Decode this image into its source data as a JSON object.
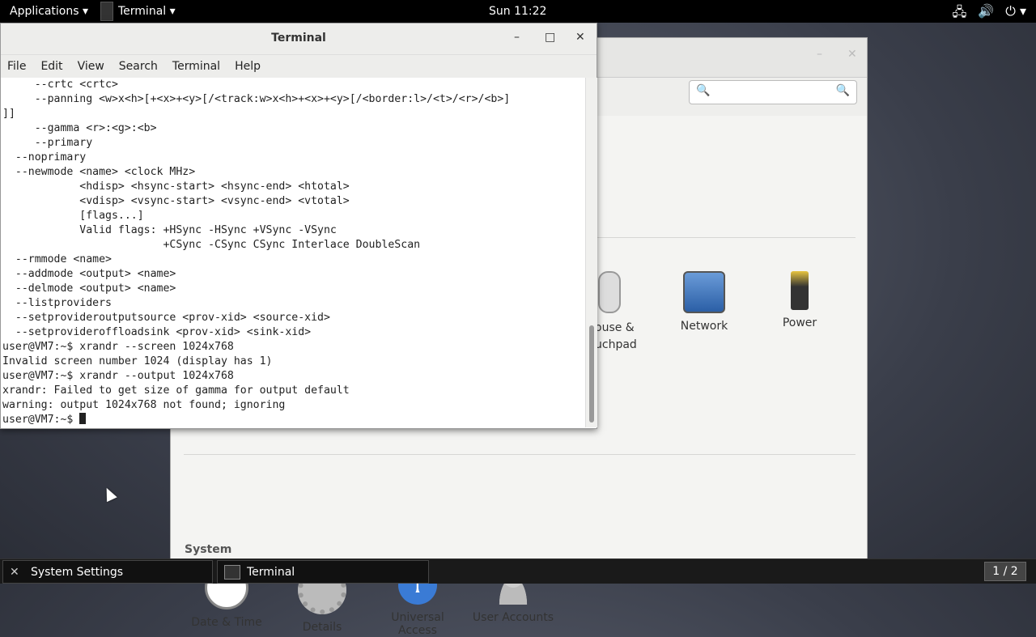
{
  "topbar": {
    "applications": "Applications ▾",
    "active_app": "Terminal ▾",
    "clock": "Sun 11:22",
    "status_icons": [
      "network-icon",
      "volume-icon",
      "power-icon"
    ]
  },
  "settings": {
    "search_placeholder": "",
    "tiles": [
      {
        "label": "ouse &\nuchpad",
        "icon": "mouse-icon"
      },
      {
        "label": "Network",
        "icon": "network-icon"
      },
      {
        "label": "Power",
        "icon": "battery-icon"
      }
    ],
    "system_header": "System",
    "system_tiles": [
      {
        "label": "Date & Time",
        "icon": "clock-icon"
      },
      {
        "label": "Details",
        "icon": "gear-icon"
      },
      {
        "label": "Universal Access",
        "icon": "accessibility-icon"
      },
      {
        "label": "User Accounts",
        "icon": "users-icon"
      }
    ]
  },
  "terminal": {
    "title": "Terminal",
    "menu": [
      "File",
      "Edit",
      "View",
      "Search",
      "Terminal",
      "Help"
    ],
    "lines": [
      "     --crtc <crtc>",
      "     --panning <w>x<h>[+<x>+<y>[/<track:w>x<h>+<x>+<y>[/<border:l>/<t>/<r>/<b>]",
      "]]",
      "     --gamma <r>:<g>:<b>",
      "     --primary",
      "  --noprimary",
      "  --newmode <name> <clock MHz>",
      "            <hdisp> <hsync-start> <hsync-end> <htotal>",
      "            <vdisp> <vsync-start> <vsync-end> <vtotal>",
      "            [flags...]",
      "            Valid flags: +HSync -HSync +VSync -VSync",
      "                         +CSync -CSync CSync Interlace DoubleScan",
      "  --rmmode <name>",
      "  --addmode <output> <name>",
      "  --delmode <output> <name>",
      "  --listproviders",
      "  --setprovideroutputsource <prov-xid> <source-xid>",
      "  --setprovideroffloadsink <prov-xid> <sink-xid>",
      "user@VM7:~$ xrandr --screen 1024x768",
      "Invalid screen number 1024 (display has 1)",
      "user@VM7:~$ xrandr --output 1024x768",
      "xrandr: Failed to get size of gamma for output default",
      "warning: output 1024x768 not found; ignoring",
      "user@VM7:~$ "
    ]
  },
  "taskbar": {
    "items": [
      {
        "label": "System Settings",
        "icon": "settings-icon"
      },
      {
        "label": "Terminal",
        "icon": "terminal-icon"
      }
    ],
    "workspace": "1 / 2"
  }
}
